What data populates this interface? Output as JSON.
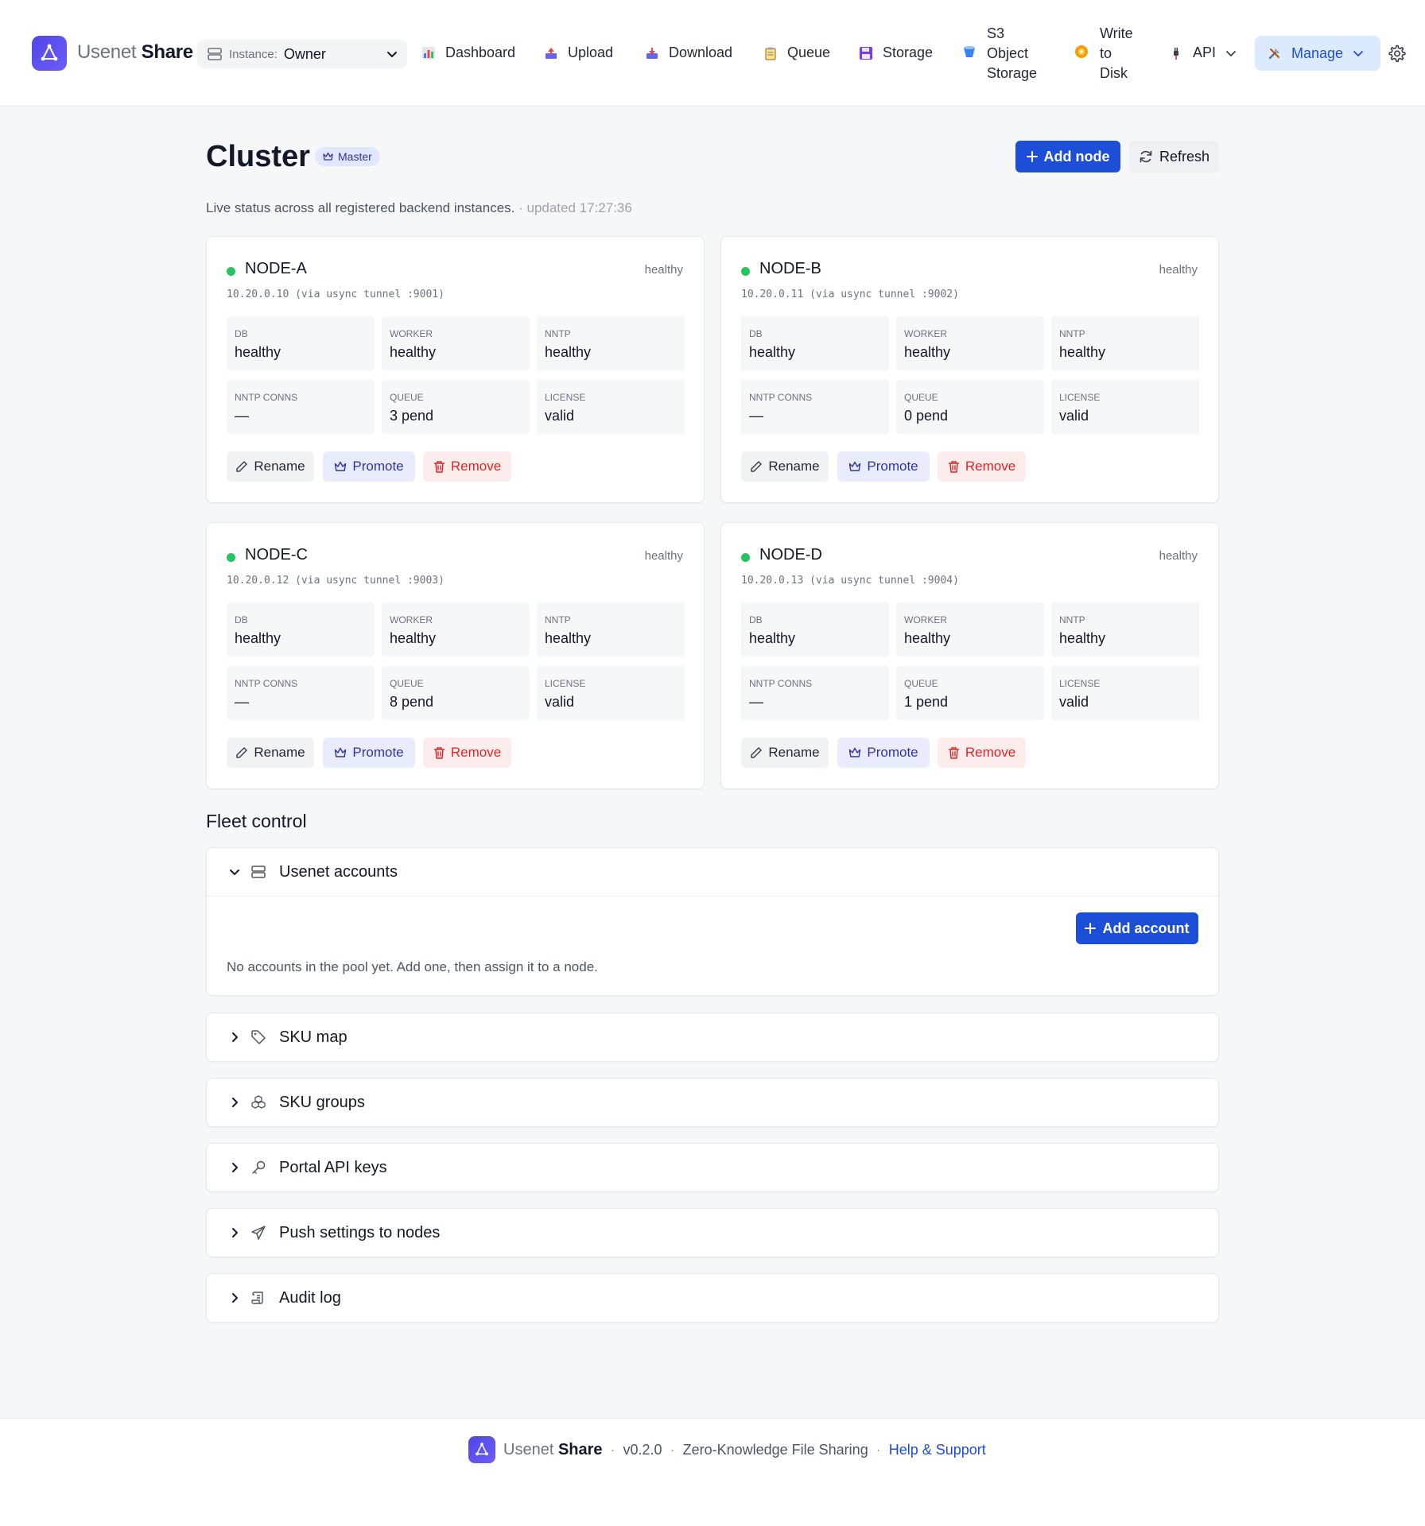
{
  "header": {
    "brand_light": "Usenet",
    "brand_bold": "Share",
    "instance_label": "Instance:",
    "instance_value": "Owner",
    "nav": {
      "dashboard": "Dashboard",
      "upload": "Upload",
      "download": "Download",
      "queue": "Queue",
      "storage": "Storage",
      "s3_line1": "S3",
      "s3_line2": "Object",
      "s3_line3": "Storage",
      "write_line1": "Write",
      "write_line2": "to",
      "write_line3": "Disk",
      "api": "API",
      "manage": "Manage"
    }
  },
  "page": {
    "title": "Cluster",
    "badge": "Master",
    "add_node": "Add node",
    "refresh": "Refresh",
    "subtitle": "Live status across all registered backend instances.",
    "updated": "· updated 17:27:36"
  },
  "metric_labels": {
    "db": "DB",
    "worker": "WORKER",
    "nntp": "NNTP",
    "nntp_conns": "NNTP CONNS",
    "queue": "QUEUE",
    "license": "LICENSE"
  },
  "card_actions": {
    "rename": "Rename",
    "promote": "Promote",
    "remove": "Remove"
  },
  "nodes": [
    {
      "name": "NODE-A",
      "status": "healthy",
      "address": "10.20.0.10 (via usync tunnel :9001)",
      "db": "healthy",
      "worker": "healthy",
      "nntp": "healthy",
      "nntp_conns": "—",
      "queue": "3 pend",
      "license": "valid"
    },
    {
      "name": "NODE-B",
      "status": "healthy",
      "address": "10.20.0.11 (via usync tunnel :9002)",
      "db": "healthy",
      "worker": "healthy",
      "nntp": "healthy",
      "nntp_conns": "—",
      "queue": "0 pend",
      "license": "valid"
    },
    {
      "name": "NODE-C",
      "status": "healthy",
      "address": "10.20.0.12 (via usync tunnel :9003)",
      "db": "healthy",
      "worker": "healthy",
      "nntp": "healthy",
      "nntp_conns": "—",
      "queue": "8 pend",
      "license": "valid"
    },
    {
      "name": "NODE-D",
      "status": "healthy",
      "address": "10.20.0.13 (via usync tunnel :9004)",
      "db": "healthy",
      "worker": "healthy",
      "nntp": "healthy",
      "nntp_conns": "—",
      "queue": "1 pend",
      "license": "valid"
    }
  ],
  "fleet": {
    "title": "Fleet control",
    "accounts_title": "Usenet accounts",
    "add_account": "Add account",
    "empty": "No accounts in the pool yet. Add one, then assign it to a node.",
    "sku_map": "SKU map",
    "sku_groups": "SKU groups",
    "portal_keys": "Portal API keys",
    "push_settings": "Push settings to nodes",
    "audit_log": "Audit log"
  },
  "footer": {
    "brand_light": "Usenet",
    "brand_bold": "Share",
    "version": "v0.2.0",
    "tagline": "Zero-Knowledge File Sharing",
    "help": "Help & Support",
    "sep": "·"
  },
  "colors": {
    "accent": "#1d4ed8",
    "healthy": "#22c55e",
    "danger": "#dc2626",
    "promote": "#3730a3"
  }
}
